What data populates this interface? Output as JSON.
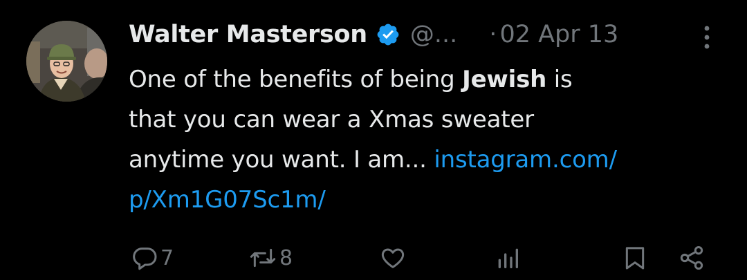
{
  "author": {
    "display_name": "Walter Masterson",
    "handle": "@...",
    "verified": true,
    "avatar_icon": "profile-photo"
  },
  "meta": {
    "separator": "·",
    "date": "02 Apr 13",
    "more_icon": "more-vertical-icon"
  },
  "post": {
    "line1_pre": "One of the benefits of being ",
    "line1_bold": "Jewish",
    "line1_post": " is",
    "line2": "that you can wear a Xmas sweater",
    "line3_text": "anytime you want. I am... ",
    "link_part1": "instagram.com/",
    "link_part2": "p/Xm1G07Sc1m/"
  },
  "actions": {
    "reply_count": "7",
    "repost_count": "8",
    "like_count": "",
    "views_count": "",
    "icons": [
      "reply-icon",
      "repost-icon",
      "like-icon",
      "views-icon",
      "bookmark-icon",
      "share-icon"
    ]
  },
  "colors": {
    "background": "#000000",
    "primary_text": "#e7e9ea",
    "secondary_text": "#71767b",
    "link": "#1d9bf0",
    "verified_badge": "#1d9bf0"
  }
}
